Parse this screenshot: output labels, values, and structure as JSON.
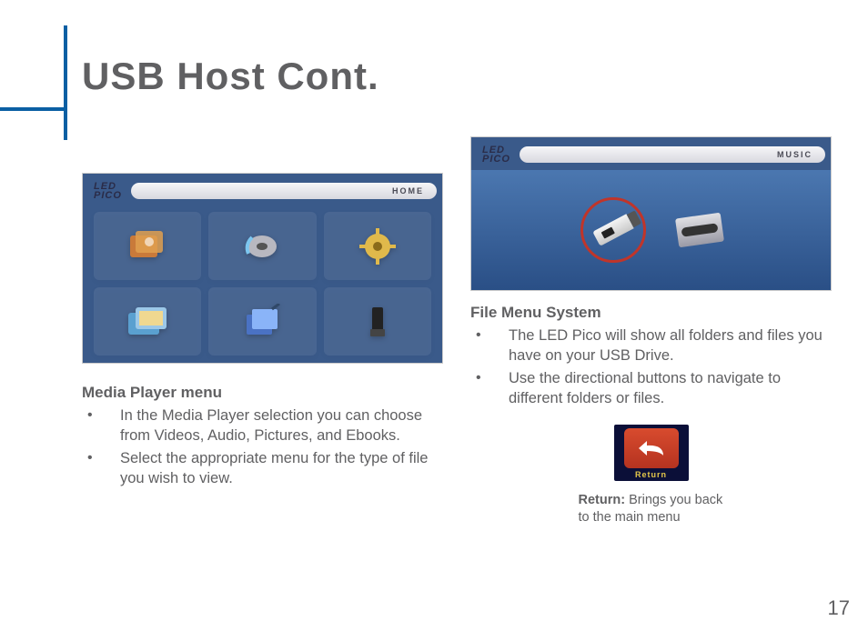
{
  "page": {
    "title": "USB Host Cont.",
    "number": "17"
  },
  "left": {
    "screenshot": {
      "brand_line1": "LED",
      "brand_line2": "PICO",
      "pill_label": "HOME",
      "icons": [
        "videos-icon",
        "audio-icon",
        "settings-icon",
        "pictures-icon",
        "ebooks-icon",
        "hdmi-icon"
      ]
    },
    "heading": "Media Player menu",
    "bullets": [
      "In the Media Player selection you can choose from Videos, Audio, Pictures, and Ebooks.",
      "Select the appropriate menu for the type of file you wish to view."
    ]
  },
  "right": {
    "screenshot": {
      "brand_line1": "LED",
      "brand_line2": "PICO",
      "pill_label": "MUSIC"
    },
    "heading": "File Menu System",
    "bullets": [
      "The LED Pico will show all folders and files you have on your USB Drive.",
      "Use the directional buttons to navigate to different folders or files."
    ],
    "return": {
      "button_label": "Return",
      "caption_bold": "Return:",
      "caption_rest": " Brings you back to the main menu"
    }
  }
}
